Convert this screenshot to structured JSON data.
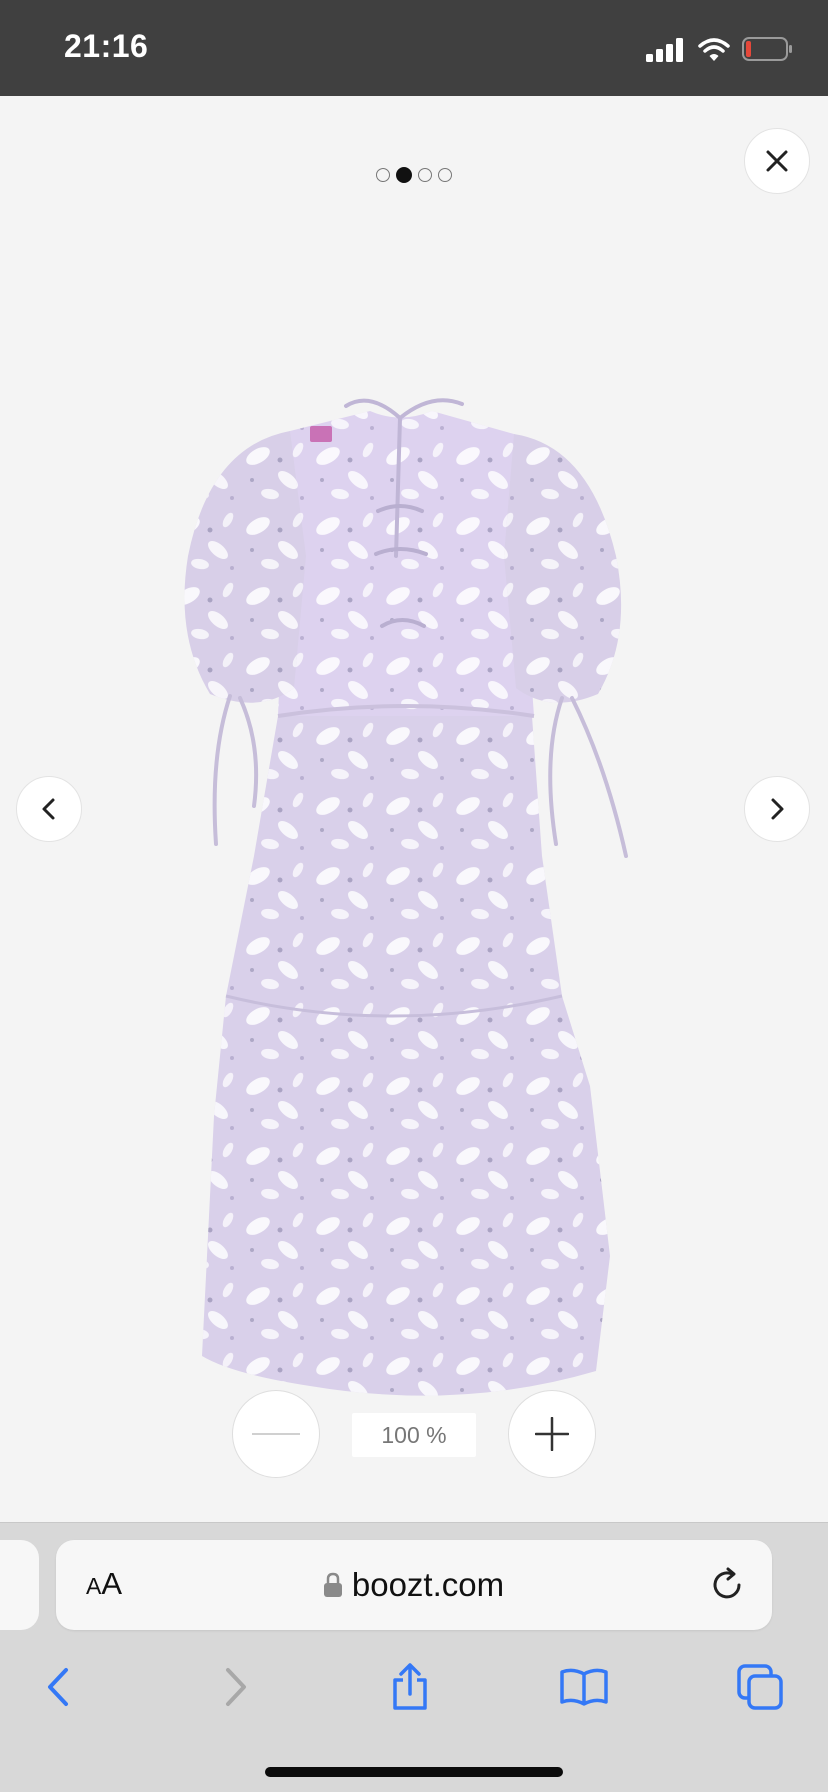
{
  "status_bar": {
    "time": "21:16"
  },
  "gallery": {
    "image_count": 4,
    "active_index": 1,
    "image_alt": "Lilac floral organza midi dress with puff sleeves and tie details, back view"
  },
  "zoom": {
    "level": "100 %"
  },
  "browser": {
    "text_size_big": "A",
    "text_size_small": "A",
    "url": "boozt.com"
  },
  "colors": {
    "accent": "#3478f6",
    "status_bg": "#404040",
    "viewer_bg": "#f4f4f4"
  }
}
